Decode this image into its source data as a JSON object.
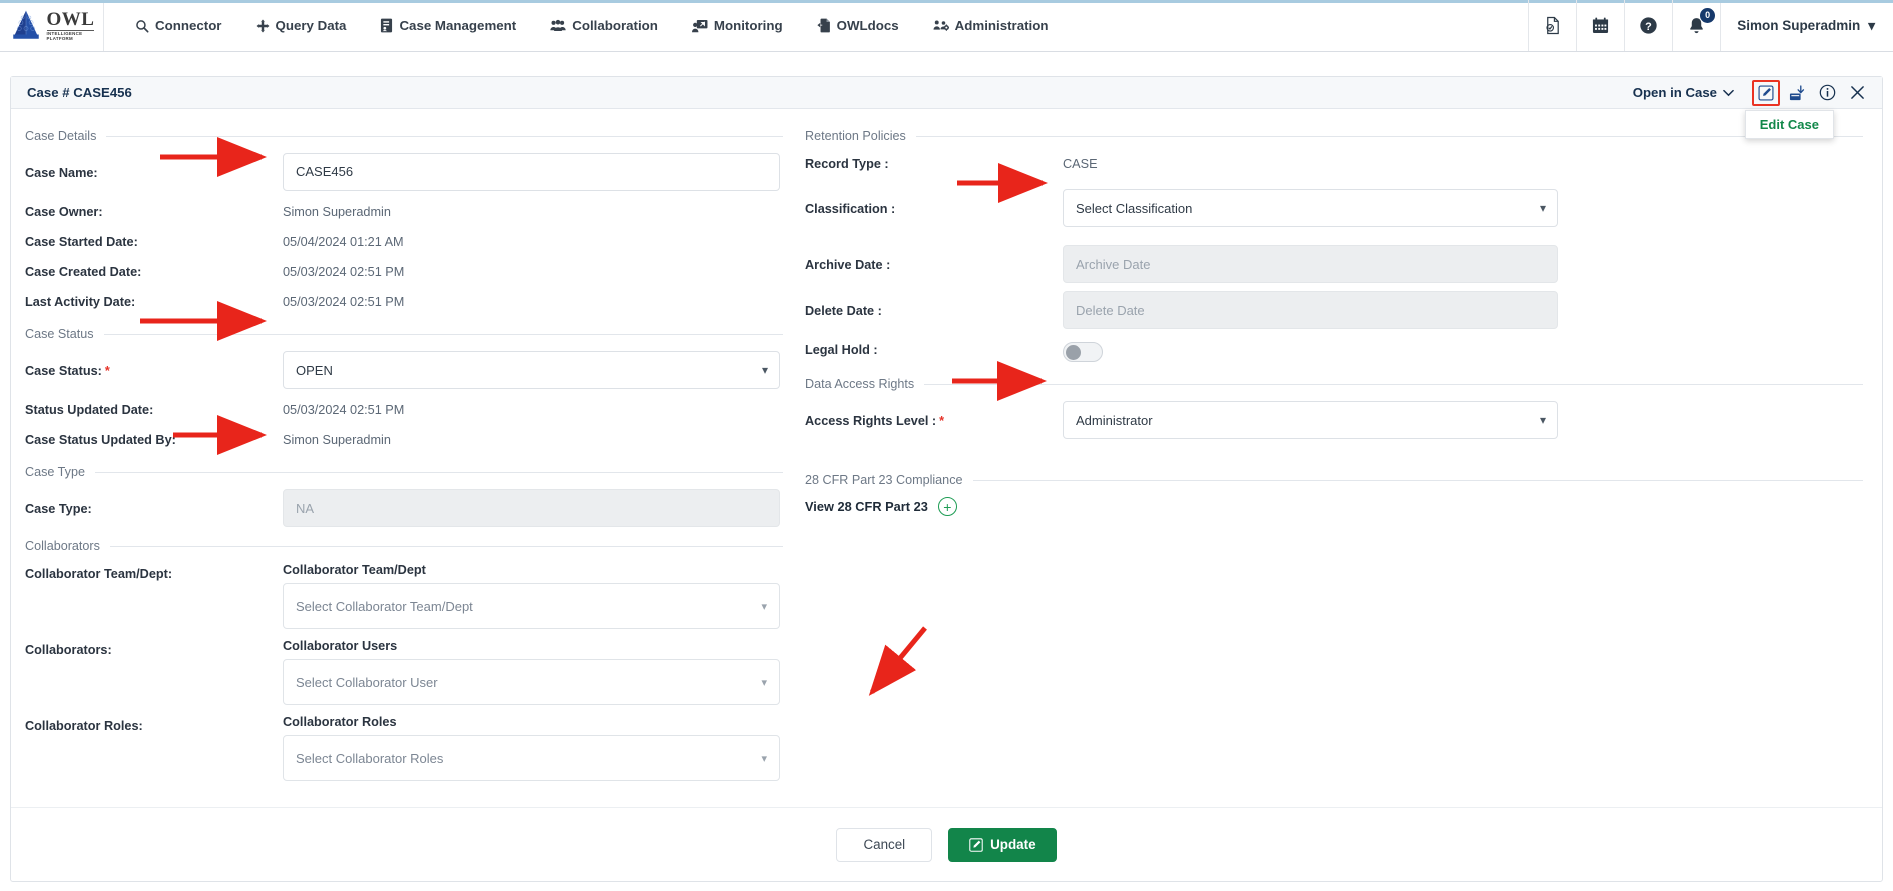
{
  "navbar": {
    "logo": {
      "name": "OWL",
      "tagline_line1": "INTELLIGENCE",
      "tagline_line2": "PLATFORM"
    },
    "items": [
      {
        "label": "Connector",
        "icon": "search-icon"
      },
      {
        "label": "Query Data",
        "icon": "arrows-move-icon"
      },
      {
        "label": "Case Management",
        "icon": "case-file-icon"
      },
      {
        "label": "Collaboration",
        "icon": "users-icon"
      },
      {
        "label": "Monitoring",
        "icon": "monitor-user-icon"
      },
      {
        "label": "OWLdocs",
        "icon": "document-export-icon"
      },
      {
        "label": "Administration",
        "icon": "admin-cog-users-icon"
      }
    ],
    "right_icons": [
      {
        "name": "report-document-icon"
      },
      {
        "name": "calendar-icon"
      },
      {
        "name": "help-circle-icon"
      },
      {
        "name": "notification-bell-icon",
        "badge": "0"
      }
    ],
    "user": {
      "name": "Simon Superadmin",
      "caret": "▾"
    }
  },
  "card": {
    "title": "Case # CASE456",
    "open_in_case": "Open in Case",
    "actions": [
      {
        "name": "edit-case-icon",
        "active": true
      },
      {
        "name": "export-case-icon",
        "active": false
      },
      {
        "name": "info-icon",
        "active": false
      },
      {
        "name": "close-icon",
        "active": false
      }
    ],
    "tooltip": "Edit Case"
  },
  "left": {
    "sections": {
      "case_details": "Case Details",
      "case_status": "Case Status",
      "case_type": "Case Type",
      "collaborators": "Collaborators"
    },
    "case_name": {
      "label": "Case Name:",
      "value": "CASE456"
    },
    "case_owner": {
      "label": "Case Owner:",
      "value": "Simon Superadmin"
    },
    "case_started_date": {
      "label": "Case Started Date:",
      "value": "05/04/2024 01:21 AM"
    },
    "case_created_date": {
      "label": "Case Created Date:",
      "value": "05/03/2024 02:51 PM"
    },
    "last_activity_date": {
      "label": "Last Activity Date:",
      "value": "05/03/2024 02:51 PM"
    },
    "case_status": {
      "label": "Case Status:",
      "value": "OPEN",
      "required": true
    },
    "status_updated_date": {
      "label": "Status Updated Date:",
      "value": "05/03/2024 02:51 PM"
    },
    "case_status_updated_by": {
      "label": "Case Status Updated By:",
      "value": "Simon Superadmin"
    },
    "case_type": {
      "label": "Case Type:",
      "value": "NA"
    },
    "collab_team": {
      "label": "Collaborator Team/Dept:",
      "sub_label": "Collaborator Team/Dept",
      "placeholder": "Select Collaborator Team/Dept"
    },
    "collab_users": {
      "label": "Collaborators:",
      "sub_label": "Collaborator Users",
      "placeholder": "Select Collaborator User"
    },
    "collab_roles": {
      "label": "Collaborator Roles:",
      "sub_label": "Collaborator Roles",
      "placeholder": "Select Collaborator Roles"
    }
  },
  "right": {
    "sections": {
      "retention_policies": "Retention Policies",
      "data_access_rights": "Data Access Rights",
      "cfr_compliance": "28 CFR Part 23 Compliance"
    },
    "record_type": {
      "label": "Record Type :",
      "value": "CASE"
    },
    "classification": {
      "label": "Classification :",
      "value": "Select Classification"
    },
    "archive_date": {
      "label": "Archive Date :",
      "placeholder": "Archive Date"
    },
    "delete_date": {
      "label": "Delete Date :",
      "placeholder": "Delete Date"
    },
    "legal_hold": {
      "label": "Legal Hold :",
      "state": "off"
    },
    "access_rights_level": {
      "label": "Access Rights Level :",
      "value": "Administrator",
      "required": true
    },
    "cfr_link": {
      "text": "View 28 CFR Part 23",
      "icon": "plus-circle-icon"
    }
  },
  "footer": {
    "cancel": "Cancel",
    "update": "Update"
  },
  "colors": {
    "brand_blue": "#1d4f91",
    "accent_green": "#12854a",
    "required_red": "#e63329",
    "annotation_red": "#ea3323"
  }
}
